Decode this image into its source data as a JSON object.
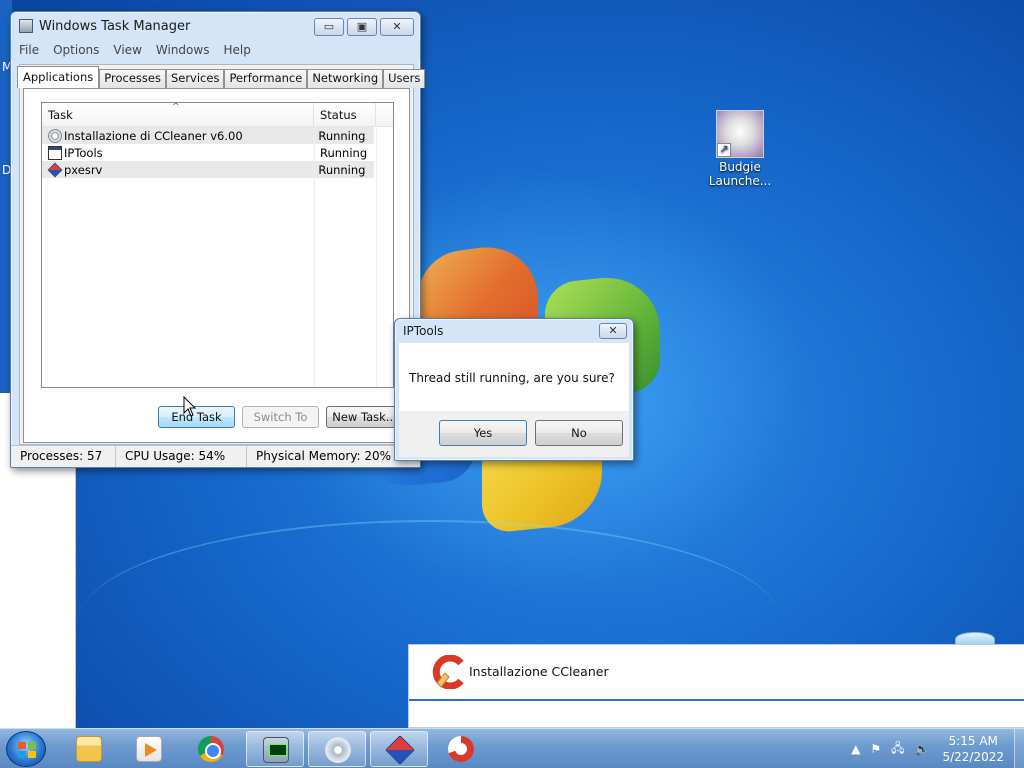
{
  "desktop": {
    "edge_letters": [
      "M",
      "D"
    ],
    "icons": [
      {
        "label_line1": "Budgie",
        "label_line2": "Launche..."
      }
    ]
  },
  "task_manager": {
    "title": "Windows Task Manager",
    "title_buttons": {
      "minimize": "▭",
      "maximize": "▣",
      "close": "✕"
    },
    "menu": [
      "File",
      "Options",
      "View",
      "Windows",
      "Help"
    ],
    "tabs": [
      "Applications",
      "Processes",
      "Services",
      "Performance",
      "Networking",
      "Users"
    ],
    "active_tab": "Applications",
    "columns": {
      "task": "Task",
      "status": "Status"
    },
    "sort_indicator": "^",
    "rows": [
      {
        "task": "Installazione di CCleaner v6.00",
        "status": "Running",
        "icon": "setup-disc-icon"
      },
      {
        "task": "IPTools",
        "status": "Running",
        "icon": "app-window-icon"
      },
      {
        "task": "pxesrv",
        "status": "Running",
        "icon": "cube-icon"
      }
    ],
    "buttons": {
      "end_task": "End Task",
      "switch_to": "Switch To",
      "new_task": "New Task..."
    },
    "statusbar": {
      "processes": "Processes: 57",
      "cpu": "CPU Usage: 54%",
      "memory": "Physical Memory: 20%"
    }
  },
  "dialog": {
    "title": "IPTools",
    "close": "✕",
    "message": "Thread still running, are you sure?",
    "yes": "Yes",
    "no": "No"
  },
  "ccleaner_installer": {
    "title": "Installazione CCleaner"
  },
  "taskbar": {
    "apps": [
      "folder-icon",
      "media-player-icon",
      "chrome-icon",
      "task-manager-icon",
      "setup-disc-icon",
      "cube-icon",
      "ccleaner-icon"
    ],
    "tray": {
      "arrow": "▲",
      "flag": "⚑",
      "network": "🖧",
      "volume": "🔈"
    },
    "time": "5:15 AM",
    "date": "5/22/2022"
  }
}
